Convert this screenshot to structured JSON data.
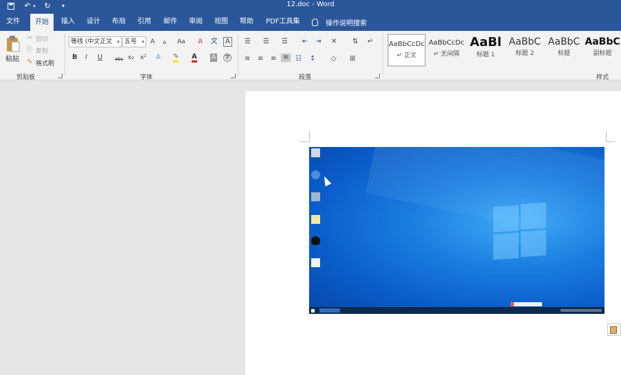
{
  "window": {
    "title": "12.doc  -  Word"
  },
  "quick_access": {
    "save_icon": "save-icon",
    "undo_icon": "undo-icon",
    "redo_icon": "redo-icon",
    "customize": "▾"
  },
  "tabs": [
    {
      "label": "文件"
    },
    {
      "label": "开始"
    },
    {
      "label": "插入"
    },
    {
      "label": "设计"
    },
    {
      "label": "布局"
    },
    {
      "label": "引用"
    },
    {
      "label": "邮件"
    },
    {
      "label": "审阅"
    },
    {
      "label": "视图"
    },
    {
      "label": "帮助"
    },
    {
      "label": "PDF工具集"
    }
  ],
  "tell_me": "操作说明搜索",
  "clipboard": {
    "paste": "粘贴",
    "cut": "剪切",
    "copy": "复制",
    "format_painter": "格式刷",
    "group": "剪贴板"
  },
  "font": {
    "name": "等线 (中文正文",
    "size": "五号",
    "grow": "A",
    "shrink": "A",
    "change_case": "Aa",
    "bold": "B",
    "italic": "I",
    "underline": "U",
    "strike": "abc",
    "subscript": "x₂",
    "superscript": "x²",
    "group": "字体"
  },
  "paragraph": {
    "group": "段落"
  },
  "styles": {
    "group": "样式",
    "items": [
      {
        "sample": "AaBbCcDc",
        "name": "↵ 正文"
      },
      {
        "sample": "AaBbCcDc",
        "name": "↵ 无间隔"
      },
      {
        "sample": "AaBl",
        "name": "标题 1"
      },
      {
        "sample": "AaBbC",
        "name": "标题 2"
      },
      {
        "sample": "AaBbC",
        "name": "标题"
      },
      {
        "sample": "AaBbC",
        "name": "副标题"
      }
    ]
  },
  "colors": {
    "accent": "#2b579a",
    "font_color": "#e02020",
    "highlight": "#f5e400"
  }
}
